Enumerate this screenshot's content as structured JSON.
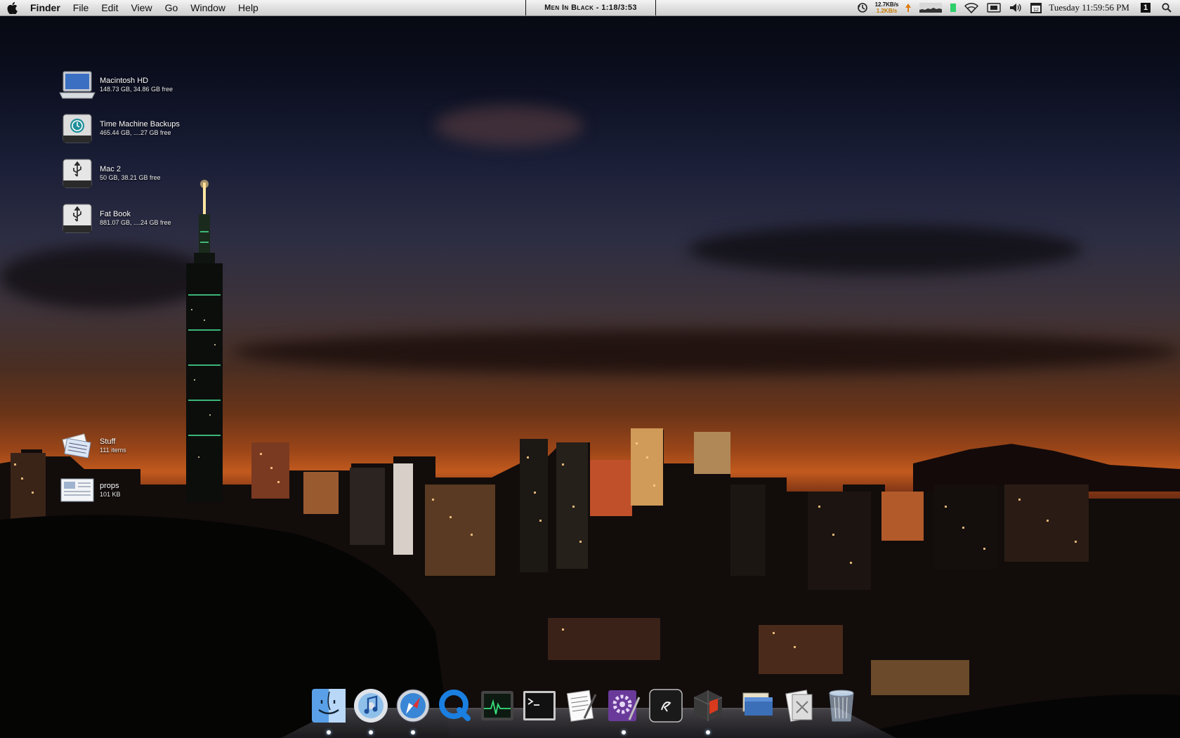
{
  "menubar": {
    "app_name": "Finder",
    "menus": [
      "File",
      "Edit",
      "View",
      "Go",
      "Window",
      "Help"
    ],
    "now_playing": "Men In Black - 1:18/3:53",
    "net_up": "12.7KB/s",
    "net_down": "1.2KB/s",
    "clock": "Tuesday 11:59:56 PM",
    "calendar_day": "12",
    "spaces_number": "1"
  },
  "desktop_icons": [
    {
      "name": "Macintosh HD",
      "info": "148.73 GB, 34.86 GB free",
      "icon": "laptop-drive-icon"
    },
    {
      "name": "Time Machine Backups",
      "info": "465.44 GB, ....27 GB free",
      "icon": "time-machine-drive-icon"
    },
    {
      "name": "Mac 2",
      "info": "50 GB, 38.21 GB free",
      "icon": "usb-drive-icon"
    },
    {
      "name": "Fat Book",
      "info": "881.07 GB, ....24 GB free",
      "icon": "usb-drive-icon"
    },
    {
      "name": "Stuff",
      "info": "111 items",
      "icon": "stack-folder-icon"
    },
    {
      "name": "props",
      "info": "101 KB",
      "icon": "document-icon"
    }
  ],
  "dock": {
    "items": [
      {
        "id": "finder",
        "icon": "finder-icon",
        "running": true
      },
      {
        "id": "itunes",
        "icon": "itunes-icon",
        "running": true
      },
      {
        "id": "safari",
        "icon": "safari-icon",
        "running": true
      },
      {
        "id": "quicktime",
        "icon": "quicktime-icon",
        "running": false
      },
      {
        "id": "activity-monitor",
        "icon": "activity-monitor-icon",
        "running": false
      },
      {
        "id": "terminal",
        "icon": "terminal-icon",
        "running": false
      },
      {
        "id": "textedit",
        "icon": "textedit-icon",
        "running": false
      },
      {
        "id": "script-editor",
        "icon": "purple-gear-app-icon",
        "running": true
      },
      {
        "id": "quicksilver",
        "icon": "quicksilver-icon",
        "running": false
      },
      {
        "id": "transmit",
        "icon": "red-box-app-icon",
        "running": true
      },
      {
        "id": "documents-stack",
        "icon": "documents-stack-icon",
        "running": false
      },
      {
        "id": "downloads-stack",
        "icon": "downloads-stack-icon",
        "running": false
      },
      {
        "id": "trash",
        "icon": "trash-icon",
        "running": false
      }
    ]
  },
  "colors": {
    "sky_top": "#07080f",
    "sunset_orange": "#c25a1e",
    "menubar": "#dedede"
  }
}
